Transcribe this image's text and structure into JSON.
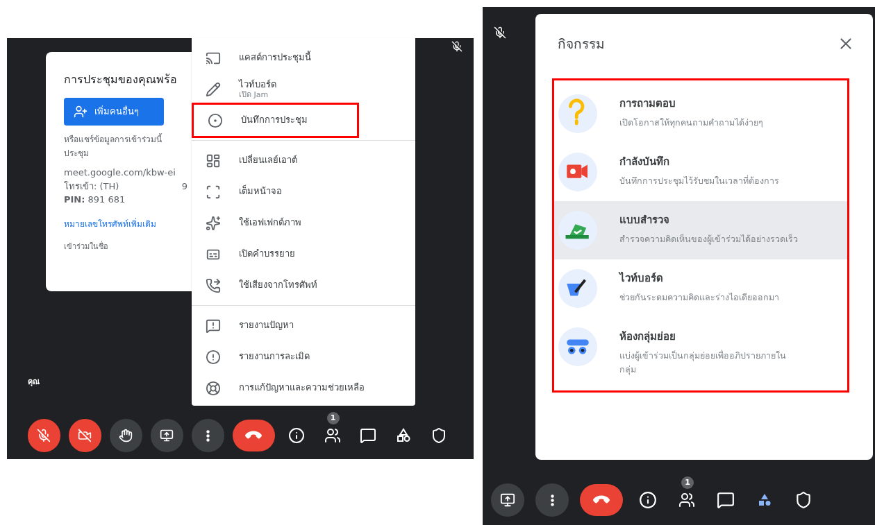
{
  "left_screen": {
    "meeting_card": {
      "title": "การประชุมของคุณพร้อ",
      "add_button": "เพิ่มคนอื่นๆ",
      "share_text": "หรือแชร์ข้อมูลการเข้าร่วมนี้\nประชุม",
      "link": "meet.google.com/kbw-ei",
      "dial_in_label": "โทรเข้า: (TH)",
      "dial_in_number": "9",
      "pin_label": "PIN:",
      "pin": "891 681",
      "more_numbers_link": "หมายเลขโทรศัพท์เพิ่มเติม",
      "joined_as": "เข้าร่วมในชื่อ"
    },
    "self_label": "คุณ",
    "menu_sections": [
      [
        {
          "label": "แคสต์การประชุมนี้",
          "annotated": false
        },
        {
          "label": "ไวท์บอร์ด",
          "sublabel": "เปิด Jam",
          "annotated": false
        },
        {
          "label": "บันทึกการประชุม",
          "annotated": true
        }
      ],
      [
        {
          "label": "เปลี่ยนเลย์เอาต์",
          "annotated": false
        },
        {
          "label": "เต็มหน้าจอ",
          "annotated": false
        },
        {
          "label": "ใช้เอฟเฟกต์ภาพ",
          "annotated": false
        },
        {
          "label": "เปิดคำบรรยาย",
          "annotated": false
        },
        {
          "label": "ใช้เสียงจากโทรศัพท์",
          "annotated": false
        }
      ],
      [
        {
          "label": "รายงานปัญหา",
          "annotated": false
        },
        {
          "label": "รายงานการละเมิด",
          "annotated": false
        },
        {
          "label": "การแก้ปัญหาและความช่วยเหลือ",
          "annotated": false
        }
      ]
    ],
    "toolbar": {
      "mic_muted": true,
      "camera_off": true,
      "people_badge": "1"
    }
  },
  "right_screen": {
    "panel": {
      "title": "กิจกรรม",
      "annotated": true,
      "activities": [
        {
          "title": "การถามตอบ",
          "description": "เปิดโอกาสให้ทุกคนถามคำถามได้ง่ายๆ",
          "highlighted": false
        },
        {
          "title": "กำลังบันทึก",
          "description": "บันทึกการประชุมไว้รับชมในเวลาที่ต้องการ",
          "highlighted": false
        },
        {
          "title": "แบบสำรวจ",
          "description": "สำรวจความคิดเห็นของผู้เข้าร่วมได้อย่างรวดเร็ว",
          "highlighted": true
        },
        {
          "title": "ไวท์บอร์ด",
          "description": "ช่วยกันระดมความคิดและร่างไอเดียออกมา",
          "highlighted": false
        },
        {
          "title": "ห้องกลุ่มย่อย",
          "description": "แบ่งผู้เข้าร่วมเป็นกลุ่มย่อยเพื่ออภิปรายภายใน\nกลุ่ม",
          "highlighted": false
        }
      ]
    },
    "toolbar": {
      "people_badge": "1",
      "activities_open": true
    }
  }
}
